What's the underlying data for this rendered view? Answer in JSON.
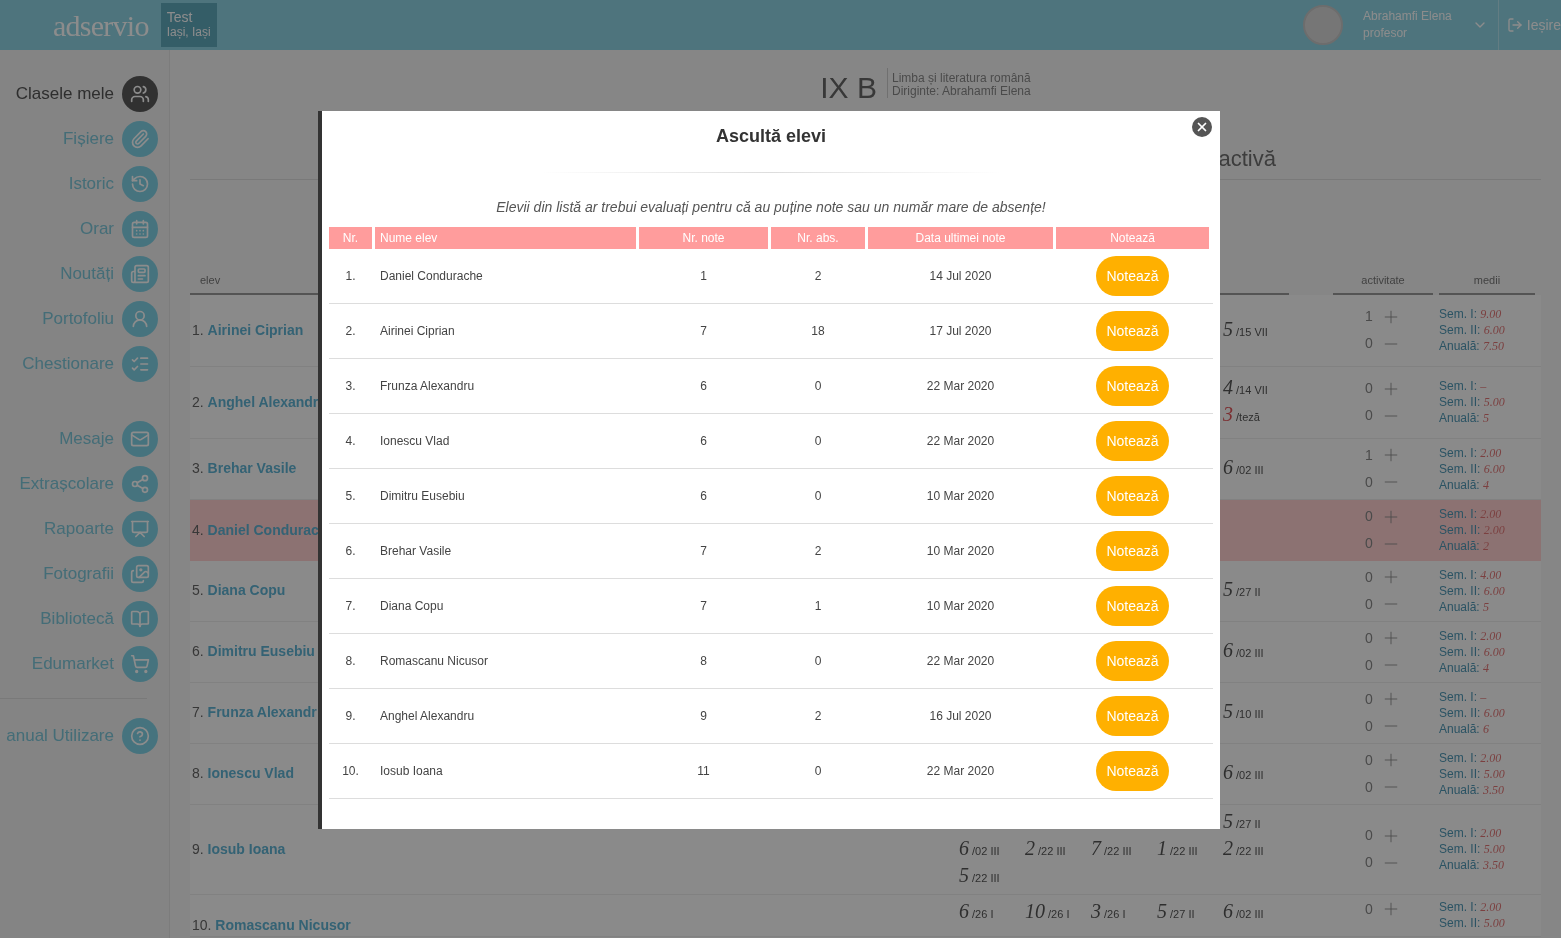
{
  "header": {
    "logo": "adservio",
    "school": {
      "name": "Test",
      "location": "Iași, Iași"
    },
    "user": {
      "name": "Abrahamfi Elena",
      "role": "profesor"
    },
    "logout": "Ieșire"
  },
  "sidebar": {
    "sections": [
      [
        {
          "label": "Clasele mele",
          "selected": true
        },
        {
          "label": "Fișiere",
          "selected": false
        },
        {
          "label": "Istoric",
          "selected": false
        },
        {
          "label": "Orar",
          "selected": false
        },
        {
          "label": "Noutăți",
          "selected": false
        },
        {
          "label": "Portofoliu",
          "selected": false
        },
        {
          "label": "Chestionare",
          "selected": false
        }
      ],
      [
        {
          "label": "Mesaje",
          "selected": false
        },
        {
          "label": "Extrașcolare",
          "selected": false
        },
        {
          "label": "Rapoarte",
          "selected": false
        },
        {
          "label": "Fotografii",
          "selected": false
        },
        {
          "label": "Bibliotecă",
          "selected": false
        },
        {
          "label": "Edumarket",
          "selected": false
        }
      ],
      [
        {
          "label": "anual Utilizare",
          "selected": false
        }
      ]
    ]
  },
  "class_page": {
    "class_name": "IX B",
    "subject": "Limba și literatura română",
    "head_teacher": "Diriginte: Abrahamfi Elena",
    "tab_fragment": "activă",
    "columns": {
      "student": "elev",
      "activity": "activitate",
      "averages": "medii"
    },
    "rows": [
      {
        "nr": "1.",
        "name": "Airinei Ciprian",
        "highlighted": false,
        "latest": [
          {
            "value": "5",
            "date": "/15 VII",
            "kind": "regular"
          }
        ],
        "plus": "1",
        "minus": "0",
        "averages": [
          {
            "label": "Sem. I:",
            "value": "9.00"
          },
          {
            "label": "Sem. II:",
            "value": "6.00"
          },
          {
            "label": "Anuală:",
            "value": "7.50"
          }
        ]
      },
      {
        "nr": "2.",
        "name": "Anghel Alexandr",
        "highlighted": false,
        "latest": [
          {
            "value": "4",
            "date": "/14 VII",
            "kind": "regular"
          },
          {
            "value": "3",
            "date": "/teză",
            "kind": "thesis"
          }
        ],
        "plus": "0",
        "minus": "0",
        "averages": [
          {
            "label": "Sem. I:",
            "value": "–"
          },
          {
            "label": "Sem. II:",
            "value": "5.00"
          },
          {
            "label": "Anuală:",
            "value": "5"
          }
        ]
      },
      {
        "nr": "3.",
        "name": "Brehar Vasile",
        "highlighted": false,
        "latest": [
          {
            "value": "6",
            "date": "/02 III",
            "kind": "regular"
          }
        ],
        "plus": "1",
        "minus": "0",
        "averages": [
          {
            "label": "Sem. I:",
            "value": "2.00"
          },
          {
            "label": "Sem. II:",
            "value": "6.00"
          },
          {
            "label": "Anuală:",
            "value": "4"
          }
        ]
      },
      {
        "nr": "4.",
        "name": "Daniel Condurac",
        "highlighted": true,
        "latest": [],
        "plus": "0",
        "minus": "0",
        "averages": [
          {
            "label": "Sem. I:",
            "value": "2.00"
          },
          {
            "label": "Sem. II:",
            "value": "2.00"
          },
          {
            "label": "Anuală:",
            "value": "2"
          }
        ]
      },
      {
        "nr": "5.",
        "name": "Diana Copu",
        "highlighted": false,
        "latest": [
          {
            "value": "5",
            "date": "/27 II",
            "kind": "regular"
          }
        ],
        "plus": "0",
        "minus": "0",
        "averages": [
          {
            "label": "Sem. I:",
            "value": "4.00"
          },
          {
            "label": "Sem. II:",
            "value": "6.00"
          },
          {
            "label": "Anuală:",
            "value": "5"
          }
        ]
      },
      {
        "nr": "6.",
        "name": "Dimitru Eusebiu",
        "highlighted": false,
        "latest": [
          {
            "value": "6",
            "date": "/02 III",
            "kind": "regular"
          }
        ],
        "plus": "0",
        "minus": "0",
        "averages": [
          {
            "label": "Sem. I:",
            "value": "2.00"
          },
          {
            "label": "Sem. II:",
            "value": "6.00"
          },
          {
            "label": "Anuală:",
            "value": "4"
          }
        ]
      },
      {
        "nr": "7.",
        "name": "Frunza Alexandr",
        "highlighted": false,
        "latest": [
          {
            "value": "5",
            "date": "/10 III",
            "kind": "regular"
          }
        ],
        "plus": "0",
        "minus": "0",
        "averages": [
          {
            "label": "Sem. I:",
            "value": "–"
          },
          {
            "label": "Sem. II:",
            "value": "6.00"
          },
          {
            "label": "Anuală:",
            "value": "6"
          }
        ]
      },
      {
        "nr": "8.",
        "name": "Ionescu Vlad",
        "highlighted": false,
        "latest": [
          {
            "value": "6",
            "date": "/02 III",
            "kind": "regular"
          }
        ],
        "plus": "0",
        "minus": "0",
        "averages": [
          {
            "label": "Sem. I:",
            "value": "2.00"
          },
          {
            "label": "Sem. II:",
            "value": "5.00"
          },
          {
            "label": "Anuală:",
            "value": "3.50"
          }
        ]
      },
      {
        "nr": "9.",
        "name": "Iosub Ioana",
        "highlighted": false,
        "latest": [
          {
            "value": "5",
            "date": "/27 II",
            "kind": "regular"
          }
        ],
        "grades": [
          {
            "value": "6",
            "date": "/02 III",
            "kind": "regular"
          },
          {
            "value": "2",
            "date": "/22 III",
            "kind": "regular"
          },
          {
            "value": "7",
            "date": "/22 III",
            "kind": "regular"
          },
          {
            "value": "1",
            "date": "/22 III",
            "kind": "regular"
          },
          {
            "value": "2",
            "date": "/22 III",
            "kind": "regular"
          },
          {
            "value": "5",
            "date": "/22 III",
            "kind": "regular"
          }
        ],
        "plus": "0",
        "minus": "0",
        "averages": [
          {
            "label": "Sem. I:",
            "value": "2.00"
          },
          {
            "label": "Sem. II:",
            "value": "5.00"
          },
          {
            "label": "Anuală:",
            "value": "3.50"
          }
        ]
      },
      {
        "nr": "10.",
        "name": "Romascanu Nicusor",
        "highlighted": false,
        "grades": [
          {
            "value": "6",
            "date": "/26 I",
            "kind": "regular"
          },
          {
            "value": "10",
            "date": "/26 I",
            "kind": "regular"
          },
          {
            "value": "3",
            "date": "/26 I",
            "kind": "regular"
          },
          {
            "value": "5",
            "date": "/27 II",
            "kind": "regular"
          },
          {
            "value": "6",
            "date": "/02 III",
            "kind": "regular"
          }
        ],
        "plus": "0",
        "averages": [
          {
            "label": "Sem. I:",
            "value": "2.00"
          },
          {
            "label": "Sem. II:",
            "value": "5.00"
          }
        ]
      }
    ]
  },
  "modal": {
    "title": "Ascultă elevi",
    "notice": "Elevii din listă ar trebui evaluați pentru că au puține note sau un număr mare de absențe!",
    "columns": [
      "Nr.",
      "Nume elev",
      "Nr. note",
      "Nr. abs.",
      "Data ultimei note",
      "Notează"
    ],
    "rows": [
      {
        "nr": "1.",
        "name": "Daniel Condurache",
        "notes": "1",
        "absences": "2",
        "last_grade_date": "14 Jul 2020",
        "action": "Notează"
      },
      {
        "nr": "2.",
        "name": "Airinei Ciprian",
        "notes": "7",
        "absences": "18",
        "last_grade_date": "17 Jul 2020",
        "action": "Notează"
      },
      {
        "nr": "3.",
        "name": "Frunza Alexandru",
        "notes": "6",
        "absences": "0",
        "last_grade_date": "22 Mar 2020",
        "action": "Notează"
      },
      {
        "nr": "4.",
        "name": "Ionescu Vlad",
        "notes": "6",
        "absences": "0",
        "last_grade_date": "22 Mar 2020",
        "action": "Notează"
      },
      {
        "nr": "5.",
        "name": "Dimitru Eusebiu",
        "notes": "6",
        "absences": "0",
        "last_grade_date": "10 Mar 2020",
        "action": "Notează"
      },
      {
        "nr": "6.",
        "name": "Brehar Vasile",
        "notes": "7",
        "absences": "2",
        "last_grade_date": "10 Mar 2020",
        "action": "Notează"
      },
      {
        "nr": "7.",
        "name": "Diana Copu",
        "notes": "7",
        "absences": "1",
        "last_grade_date": "10 Mar 2020",
        "action": "Notează"
      },
      {
        "nr": "8.",
        "name": "Romascanu Nicusor",
        "notes": "8",
        "absences": "0",
        "last_grade_date": "22 Mar 2020",
        "action": "Notează"
      },
      {
        "nr": "9.",
        "name": "Anghel Alexandru",
        "notes": "9",
        "absences": "2",
        "last_grade_date": "16 Jul 2020",
        "action": "Notează"
      },
      {
        "nr": "10.",
        "name": "Iosub Ioana",
        "notes": "11",
        "absences": "0",
        "last_grade_date": "22 Mar 2020",
        "action": "Notează"
      }
    ]
  }
}
